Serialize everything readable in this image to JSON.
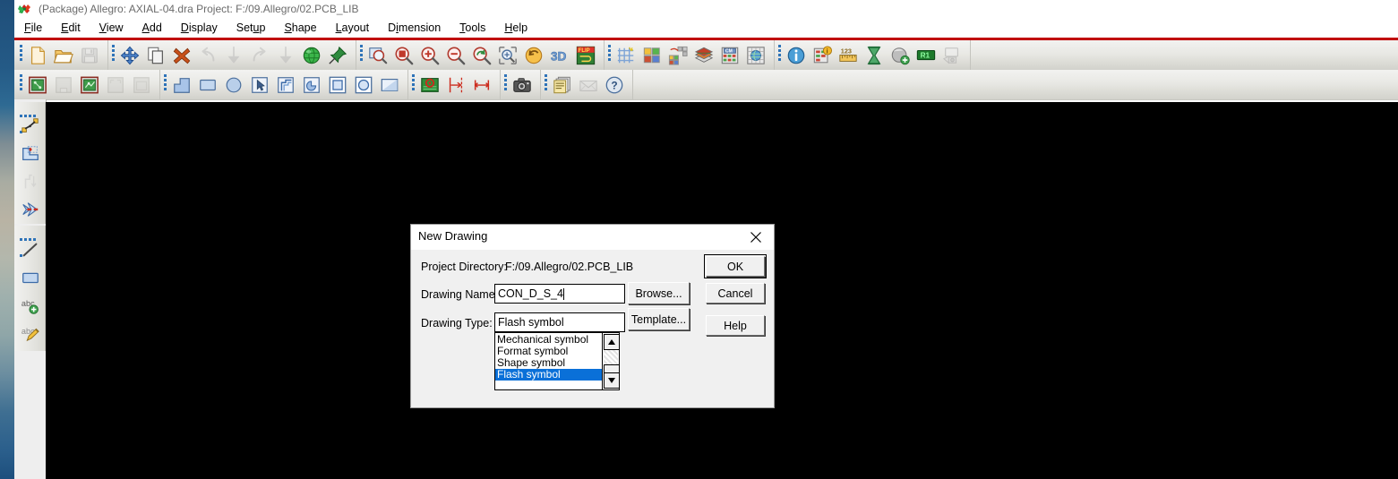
{
  "window": {
    "title": "(Package) Allegro: AXIAL-04.dra   Project: F:/09.Allegro/02.PCB_LIB",
    "app_icon": "allegro-logo-icon"
  },
  "menubar": {
    "items": [
      {
        "label": "File",
        "mnemonic": "F"
      },
      {
        "label": "Edit",
        "mnemonic": "E"
      },
      {
        "label": "View",
        "mnemonic": "V"
      },
      {
        "label": "Add",
        "mnemonic": "A"
      },
      {
        "label": "Display",
        "mnemonic": "D"
      },
      {
        "label": "Setup",
        "mnemonic": "u"
      },
      {
        "label": "Shape",
        "mnemonic": "S"
      },
      {
        "label": "Layout",
        "mnemonic": "L"
      },
      {
        "label": "Dimension",
        "mnemonic": "i"
      },
      {
        "label": "Tools",
        "mnemonic": "T"
      },
      {
        "label": "Help",
        "mnemonic": "H"
      }
    ]
  },
  "toolbar_primary": {
    "groups": [
      {
        "buttons": [
          {
            "icon": "new-file-icon",
            "tooltip": "New"
          },
          {
            "icon": "open-folder-icon",
            "tooltip": "Open"
          },
          {
            "icon": "save-icon",
            "tooltip": "Save",
            "disabled": true
          }
        ]
      },
      {
        "buttons": [
          {
            "icon": "move-icon",
            "tooltip": "Move"
          },
          {
            "icon": "copy-icon",
            "tooltip": "Copy"
          },
          {
            "icon": "delete-x-icon",
            "tooltip": "Delete"
          },
          {
            "icon": "undo-icon",
            "tooltip": "Undo",
            "disabled": true
          },
          {
            "icon": "undo-down-icon",
            "tooltip": "Undo to",
            "disabled": true
          },
          {
            "icon": "redo-icon",
            "tooltip": "Redo",
            "disabled": true
          },
          {
            "icon": "redo-down-icon",
            "tooltip": "Redo to",
            "disabled": true
          },
          {
            "icon": "globe-green-icon",
            "tooltip": "Net"
          },
          {
            "icon": "pushpin-icon",
            "tooltip": "Fix"
          }
        ]
      },
      {
        "buttons": [
          {
            "icon": "zoom-fit-icon",
            "tooltip": "Zoom Fit"
          },
          {
            "icon": "zoom-world-icon",
            "tooltip": "Zoom World"
          },
          {
            "icon": "zoom-in-icon",
            "tooltip": "Zoom In"
          },
          {
            "icon": "zoom-out-icon",
            "tooltip": "Zoom Out"
          },
          {
            "icon": "zoom-previous-icon",
            "tooltip": "Zoom Previous"
          },
          {
            "icon": "zoom-selection-icon",
            "tooltip": "Zoom Points"
          },
          {
            "icon": "refresh-icon",
            "tooltip": "Redraw"
          },
          {
            "icon": "3d-view-icon",
            "tooltip": "3D View"
          },
          {
            "icon": "flip-design-icon",
            "tooltip": "Flip Design"
          }
        ]
      },
      {
        "buttons": [
          {
            "icon": "grid-toggle-icon",
            "tooltip": "Grid Toggle"
          },
          {
            "icon": "color-palette-icon",
            "tooltip": "Color/Visibility"
          },
          {
            "icon": "layer-color-icon",
            "tooltip": "Assign Color"
          },
          {
            "icon": "layers-stack-icon",
            "tooltip": "Subclass Stack"
          },
          {
            "icon": "constraint-manager-icon",
            "tooltip": "Constraint Manager"
          },
          {
            "icon": "global-grid-icon",
            "tooltip": "Design Parameters"
          }
        ]
      },
      {
        "buttons": [
          {
            "icon": "info-icon",
            "tooltip": "Show Element"
          },
          {
            "icon": "property-edit-icon",
            "tooltip": "Edit Property"
          },
          {
            "icon": "measure-ruler-icon",
            "tooltip": "Measure"
          },
          {
            "icon": "hourglass-icon",
            "tooltip": "Status"
          },
          {
            "icon": "add-pin-icon",
            "tooltip": "Add Pin"
          },
          {
            "icon": "r1-refdes-icon",
            "tooltip": "Labels"
          },
          {
            "icon": "screen-capture-icon",
            "tooltip": "Screen Capture",
            "disabled": true
          }
        ]
      }
    ]
  },
  "toolbar_secondary": {
    "groups": [
      {
        "buttons": [
          {
            "icon": "symbol-edit-icon",
            "tooltip": "Symbol Edit"
          },
          {
            "icon": "package-blank-icon",
            "tooltip": "Package",
            "disabled": true
          },
          {
            "icon": "symbol-net-icon",
            "tooltip": "Padstack"
          },
          {
            "icon": "format-blank-icon",
            "tooltip": "Format",
            "disabled": true
          },
          {
            "icon": "mechanical-blank-icon",
            "tooltip": "Mechanical",
            "disabled": true
          }
        ]
      },
      {
        "buttons": [
          {
            "icon": "polygon-shape-icon",
            "tooltip": "Shape Add"
          },
          {
            "icon": "rect-fill-icon",
            "tooltip": "Shape Rect"
          },
          {
            "icon": "circle-fill-icon",
            "tooltip": "Shape Circle"
          },
          {
            "icon": "select-shape-icon",
            "tooltip": "Shape Select"
          },
          {
            "icon": "shape-offset-icon",
            "tooltip": "Shape Compose"
          },
          {
            "icon": "shape-rotate-icon",
            "tooltip": "Shape Decompose"
          },
          {
            "icon": "rect-outline-icon",
            "tooltip": "Rectangle"
          },
          {
            "icon": "circle-outline-icon",
            "tooltip": "Circle"
          },
          {
            "icon": "shape-void-icon",
            "tooltip": "Shape Void"
          }
        ]
      },
      {
        "buttons": [
          {
            "icon": "pad-green-icon",
            "tooltip": "Add Pin"
          },
          {
            "icon": "dimension-line-icon",
            "tooltip": "Datum"
          },
          {
            "icon": "dimension-arrow-icon",
            "tooltip": "Linear Dimension"
          }
        ]
      },
      {
        "buttons": [
          {
            "icon": "camera-icon",
            "tooltip": "Snapshot"
          }
        ]
      },
      {
        "buttons": [
          {
            "icon": "reports-icon",
            "tooltip": "Reports"
          },
          {
            "icon": "mail-icon",
            "tooltip": "Mail",
            "disabled": true
          },
          {
            "icon": "help-question-icon",
            "tooltip": "Help"
          }
        ]
      }
    ]
  },
  "toolbar_left": {
    "groups": [
      {
        "buttons": [
          {
            "icon": "add-line-icon",
            "tooltip": "Add Line"
          },
          {
            "icon": "move-element-icon",
            "tooltip": "Move"
          },
          {
            "icon": "slide-icon",
            "tooltip": "Slide",
            "disabled": true
          },
          {
            "icon": "delete-segment-icon",
            "tooltip": "Delete"
          }
        ]
      },
      {
        "buttons": [
          {
            "icon": "line-draw-icon",
            "tooltip": "Line"
          },
          {
            "icon": "rect-draw-icon",
            "tooltip": "Rectangle"
          },
          {
            "icon": "add-text-icon",
            "tooltip": "Add Text"
          },
          {
            "icon": "edit-text-icon",
            "tooltip": "Edit Text"
          }
        ]
      }
    ]
  },
  "dialog": {
    "title": "New Drawing",
    "close_glyph": "✕",
    "project_directory_label": "Project Directory:",
    "project_directory_value": "F:/09.Allegro/02.PCB_LIB",
    "drawing_name_label": "Drawing Name:",
    "drawing_name_value": "CON_D_S_4",
    "drawing_type_label": "Drawing Type:",
    "drawing_type_value": "Flash symbol",
    "type_options": [
      {
        "label": "Mechanical symbol",
        "selected": false
      },
      {
        "label": "Format symbol",
        "selected": false
      },
      {
        "label": "Shape symbol",
        "selected": false
      },
      {
        "label": "Flash symbol",
        "selected": true
      }
    ],
    "buttons": {
      "browse": "Browse...",
      "template": "Template...",
      "ok": "OK",
      "cancel": "Cancel",
      "help": "Help"
    }
  },
  "colors": {
    "accent_red": "#c00000",
    "selection_blue": "#0a70d8",
    "toolbar_face": "#e8e8e4",
    "dialog_face": "#f0f0f0",
    "canvas_black": "#000000",
    "grip_blue": "#2e73b8"
  }
}
